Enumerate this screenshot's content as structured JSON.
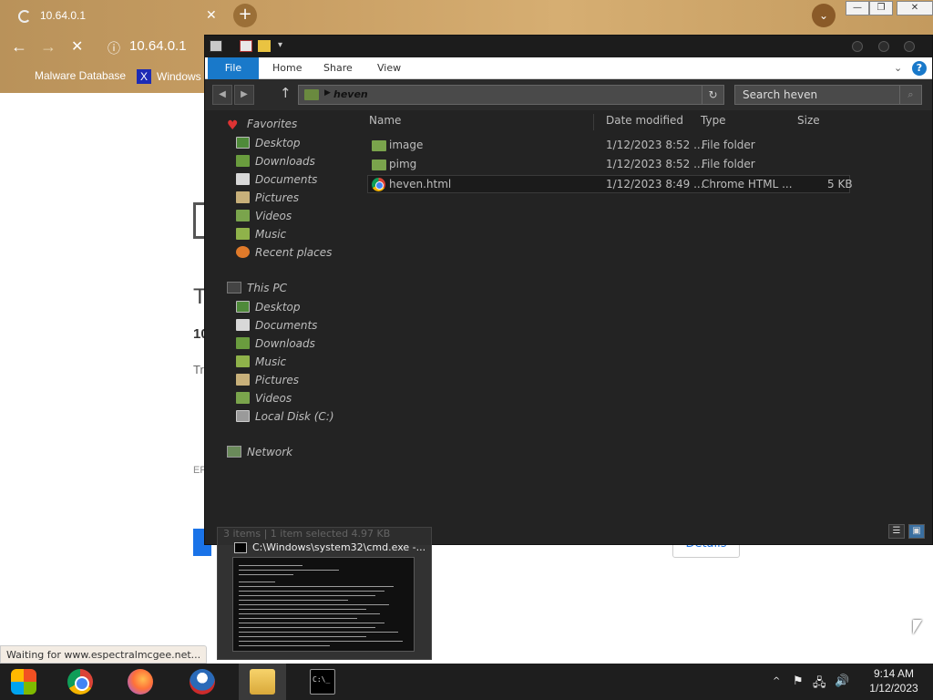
{
  "browser": {
    "tab_title": "10.64.0.1",
    "url": "10.64.0.1",
    "bookmarks": [
      "Malware Database",
      "Windows :"
    ],
    "status_text": "Waiting for www.espectralmcgee.net...",
    "page_fragments": [
      "T",
      "10",
      "Tr",
      "ER"
    ],
    "details_label": "Details"
  },
  "explorer": {
    "ribbon_tabs": [
      "File",
      "Home",
      "Share",
      "View"
    ],
    "address_path": "heven",
    "search_placeholder": "Search heven",
    "nav": {
      "favorites_label": "Favorites",
      "favorites": [
        "Desktop",
        "Downloads",
        "Documents",
        "Pictures",
        "Videos",
        "Music",
        "Recent places"
      ],
      "thispc_label": "This PC",
      "thispc": [
        "Desktop",
        "Documents",
        "Downloads",
        "Music",
        "Pictures",
        "Videos",
        "Local Disk (C:)"
      ],
      "network_label": "Network"
    },
    "columns": [
      "Name",
      "Date modified",
      "Type",
      "Size"
    ],
    "files": [
      {
        "name": "image",
        "date": "1/12/2023 8:52 ...",
        "type": "File folder",
        "size": ""
      },
      {
        "name": "pimg",
        "date": "1/12/2023 8:52 ...",
        "type": "File folder",
        "size": ""
      },
      {
        "name": "heven.html",
        "date": "1/12/2023 8:49 ...",
        "type": "Chrome HTML ...",
        "size": "5 KB"
      }
    ],
    "status_ghost": "3 items | 1 item selected  4.97 KB"
  },
  "cmd_thumbnail": {
    "title": "C:\\Windows\\system32\\cmd.exe -..."
  },
  "taskbar": {
    "time": "9:14 AM",
    "date": "1/12/2023"
  },
  "colors": {
    "ribbon_file_tab": "#1979ca",
    "explorer_bg": "#232323",
    "taskbar_bg": "#1e1e1e"
  }
}
